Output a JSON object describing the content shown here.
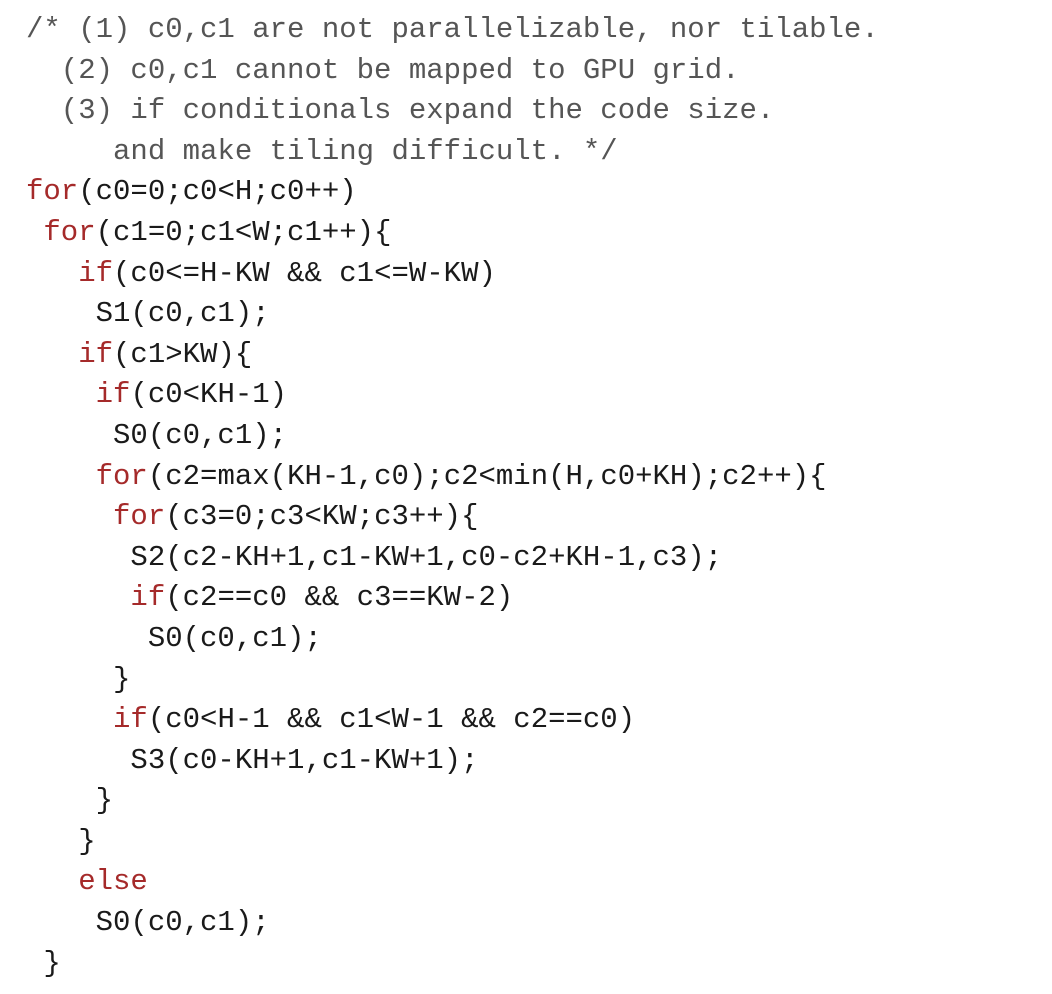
{
  "code_lines": [
    [
      {
        "t": "/* (1) c0,c1 are not parallelizable, nor tilable.",
        "c": "comment"
      }
    ],
    [
      {
        "t": "  (2) c0,c1 cannot be mapped to GPU grid.",
        "c": "comment"
      }
    ],
    [
      {
        "t": "  (3) if conditionals expand the code size.",
        "c": "comment"
      }
    ],
    [
      {
        "t": "     and make tiling difficult. */",
        "c": "comment"
      }
    ],
    [
      {
        "t": "for",
        "c": "kw"
      },
      {
        "t": "(c0=0;c0<H;c0++)",
        "c": "plain"
      }
    ],
    [
      {
        "t": " ",
        "c": "plain"
      },
      {
        "t": "for",
        "c": "kw"
      },
      {
        "t": "(c1=0;c1<W;c1++){",
        "c": "plain"
      }
    ],
    [
      {
        "t": "   ",
        "c": "plain"
      },
      {
        "t": "if",
        "c": "kw"
      },
      {
        "t": "(c0<=H-KW && c1<=W-KW)",
        "c": "plain"
      }
    ],
    [
      {
        "t": "    S1(c0,c1);",
        "c": "plain"
      }
    ],
    [
      {
        "t": "   ",
        "c": "plain"
      },
      {
        "t": "if",
        "c": "kw"
      },
      {
        "t": "(c1>KW){",
        "c": "plain"
      }
    ],
    [
      {
        "t": "    ",
        "c": "plain"
      },
      {
        "t": "if",
        "c": "kw"
      },
      {
        "t": "(c0<KH-1)",
        "c": "plain"
      }
    ],
    [
      {
        "t": "     S0(c0,c1);",
        "c": "plain"
      }
    ],
    [
      {
        "t": "    ",
        "c": "plain"
      },
      {
        "t": "for",
        "c": "kw"
      },
      {
        "t": "(c2=max(KH-1,c0);c2<min(H,c0+KH);c2++){",
        "c": "plain"
      }
    ],
    [
      {
        "t": "     ",
        "c": "plain"
      },
      {
        "t": "for",
        "c": "kw"
      },
      {
        "t": "(c3=0;c3<KW;c3++){",
        "c": "plain"
      }
    ],
    [
      {
        "t": "      S2(c2-KH+1,c1-KW+1,c0-c2+KH-1,c3);",
        "c": "plain"
      }
    ],
    [
      {
        "t": "      ",
        "c": "plain"
      },
      {
        "t": "if",
        "c": "kw"
      },
      {
        "t": "(c2==c0 && c3==KW-2)",
        "c": "plain"
      }
    ],
    [
      {
        "t": "       S0(c0,c1);",
        "c": "plain"
      }
    ],
    [
      {
        "t": "     }",
        "c": "plain"
      }
    ],
    [
      {
        "t": "     ",
        "c": "plain"
      },
      {
        "t": "if",
        "c": "kw"
      },
      {
        "t": "(c0<H-1 && c1<W-1 && c2==c0)",
        "c": "plain"
      }
    ],
    [
      {
        "t": "      S3(c0-KH+1,c1-KW+1);",
        "c": "plain"
      }
    ],
    [
      {
        "t": "    }",
        "c": "plain"
      }
    ],
    [
      {
        "t": "   }",
        "c": "plain"
      }
    ],
    [
      {
        "t": "   else",
        "c": "kw"
      }
    ],
    [
      {
        "t": "    S0(c0,c1);",
        "c": "plain"
      }
    ],
    [
      {
        "t": " }",
        "c": "plain"
      }
    ]
  ],
  "colors": {
    "keyword": "#a52a2a",
    "comment": "#555555",
    "text": "#1a1a1a",
    "background": "#ffffff"
  }
}
